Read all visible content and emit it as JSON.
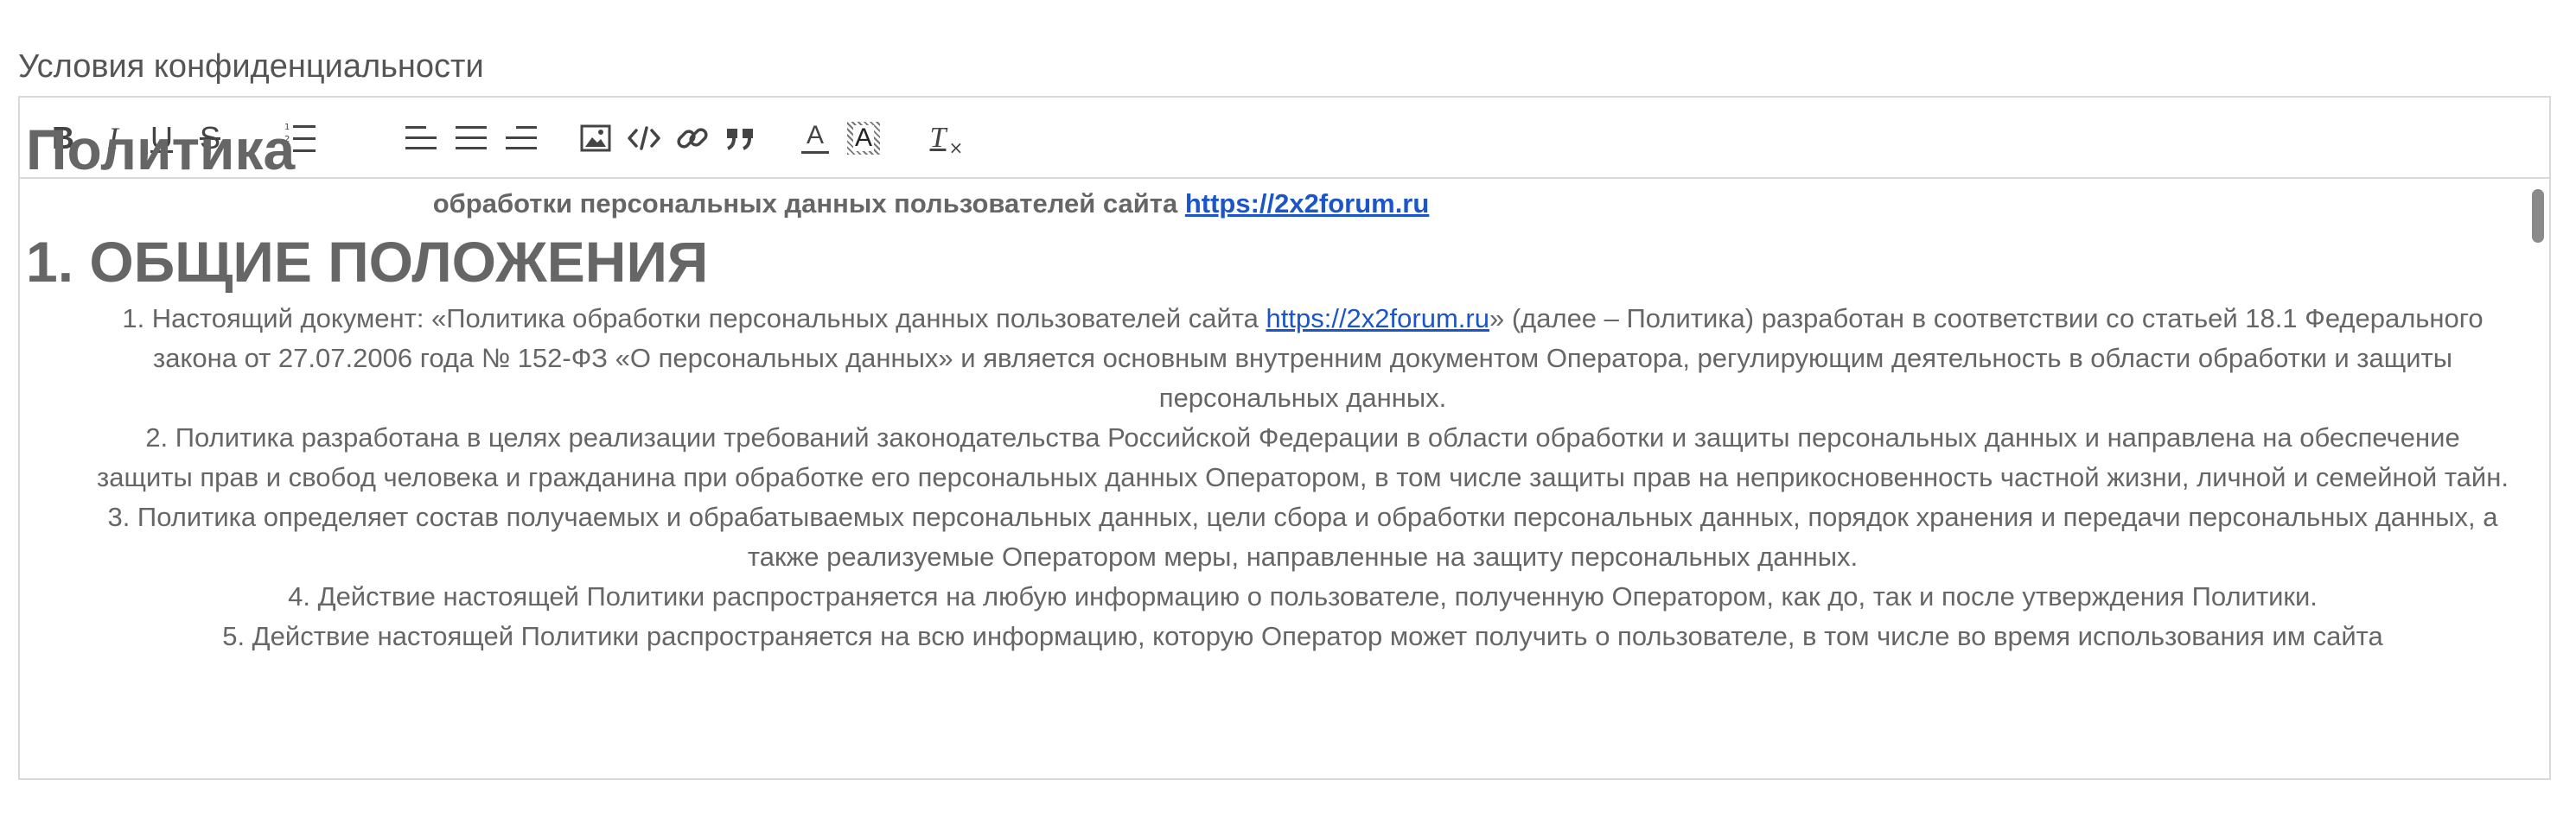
{
  "field_label": "Условия конфиденциальности",
  "toolbar": {
    "buttons": [
      {
        "name": "bold-button",
        "icon": "bold-icon",
        "glyph": "B"
      },
      {
        "name": "italic-button",
        "icon": "italic-icon",
        "glyph": "I"
      },
      {
        "name": "underline-button",
        "icon": "underline-icon",
        "glyph": "U"
      },
      {
        "name": "strikethrough-button",
        "icon": "strikethrough-icon",
        "glyph": "S"
      },
      {
        "name": "ordered-list-button",
        "icon": "ordered-list-icon"
      },
      {
        "name": "align-left-button",
        "icon": "align-left-icon"
      },
      {
        "name": "align-center-button",
        "icon": "align-center-icon"
      },
      {
        "name": "align-right-button",
        "icon": "align-right-icon"
      },
      {
        "name": "image-button",
        "icon": "image-icon"
      },
      {
        "name": "code-button",
        "icon": "code-icon"
      },
      {
        "name": "link-button",
        "icon": "link-icon"
      },
      {
        "name": "quote-button",
        "icon": "quote-icon"
      },
      {
        "name": "text-color-button",
        "icon": "text-color-icon",
        "glyph": "A"
      },
      {
        "name": "background-color-button",
        "icon": "highlight-icon",
        "glyph": "A"
      },
      {
        "name": "clear-format-button",
        "icon": "clear-format-icon",
        "glyph": "T"
      }
    ]
  },
  "document": {
    "title": "Политика",
    "subtitle_text": "обработки персональных данных пользователей сайта ",
    "subtitle_link": "https://2x2forum.ru",
    "section_heading": "1. ОБЩИЕ ПОЛОЖЕНИЯ",
    "p1_before": "1. Настоящий документ: «Политика обработки персональных данных пользователей сайта ",
    "p1_link": "https://2x2forum.ru",
    "p1_after": "» (далее – Политика) разработан в соответствии со статьей 18.1 Федерального закона от 27.07.2006 года № 152-ФЗ «О персональных данных» и является основным внутренним документом Оператора, регулирующим деятельность в области обработки и защиты персональных данных.",
    "p2": "2. Политика разработана в целях реализации требований законодательства Российской Федерации в области обработки и защиты персональных данных и направлена на обеспечение защиты прав и свобод человека и гражданина при обработке его персональных данных Оператором, в том числе защиты прав на неприкосновенность частной жизни, личной и семейной тайн.",
    "p3": "3. Политика определяет состав получаемых и обрабатываемых персональных данных, цели сбора и обработки персональных данных, порядок хранения и передачи персональных данных, а также реализуемые Оператором меры, направленные на защиту персональных данных.",
    "p4": "4. Действие настоящей Политики распространяется на любую информацию о пользователе, полученную Оператором, как до, так и после утверждения Политики.",
    "p5": "5. Действие настоящей Политики распространяется на всю информацию, которую Оператор может получить о пользователе, в том числе во время использования им сайта"
  },
  "colors": {
    "text": "#666666",
    "link": "#1a56c9",
    "border": "#d9d9d9",
    "scroll_thumb": "#8a8a8a"
  }
}
